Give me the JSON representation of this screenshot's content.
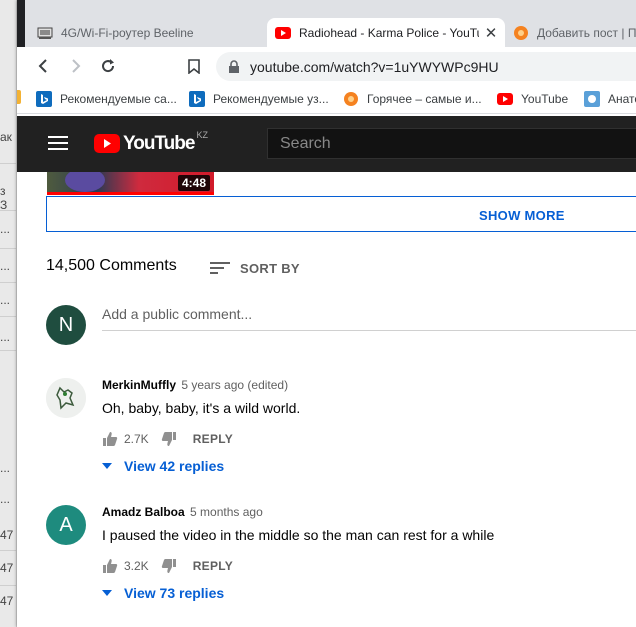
{
  "background_window": {
    "row_texts": [
      "ак",
      "з З",
      "...",
      "...",
      "...",
      "...",
      "...",
      "...",
      "47",
      "47",
      "47"
    ]
  },
  "browser": {
    "tabs": [
      {
        "label": "4G/Wi-Fi-роутер Beeline",
        "active": false
      },
      {
        "label": "Radiohead - Karma Police - YouTube",
        "active": true
      },
      {
        "label": "Добавить пост | Пикабу",
        "active": false
      }
    ],
    "address": "youtube.com/watch?v=1uYWYWPc9HU",
    "bookmarks": [
      "Рекомендуемые са...",
      "Рекомендуемые уз...",
      "Горячее – самые и...",
      "YouTube",
      "Анатомия"
    ]
  },
  "youtube": {
    "logo_text": "YouTube",
    "country_code": "KZ",
    "search_placeholder": "Search",
    "video": {
      "duration": "4:48"
    },
    "show_more": "SHOW MORE",
    "comments_count": "14,500 Comments",
    "sort_by": "SORT BY",
    "user_avatar_letter": "N",
    "add_comment_placeholder": "Add a public comment...",
    "comments": [
      {
        "author": "MerkinMuffly",
        "time": "5 years ago (edited)",
        "text": "Oh, baby, baby, it's a wild world.",
        "likes": "2.7K",
        "reply_label": "REPLY",
        "view_replies": "View 42 replies"
      },
      {
        "author": "Amadz Balboa",
        "avatar_letter": "A",
        "time": "5 months ago",
        "text": "I paused the video in the middle so the man can rest for a while",
        "likes": "3.2K",
        "reply_label": "REPLY",
        "view_replies": "View 73 replies"
      }
    ]
  },
  "colors": {
    "yt_red": "#ff0000",
    "link_blue": "#065fd4",
    "avatar_n": "#1f4d3f",
    "avatar_a": "#1e8b7e"
  }
}
